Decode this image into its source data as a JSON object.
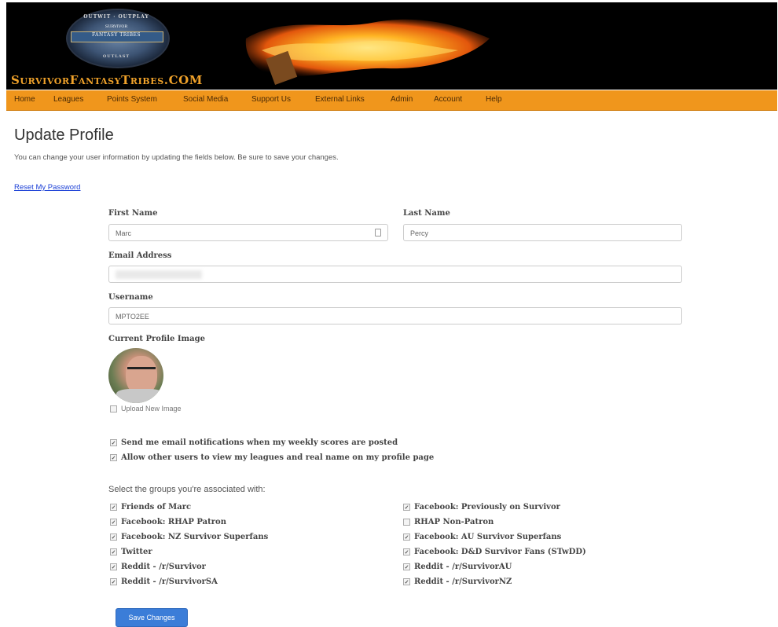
{
  "site": {
    "title": "SurvivorFantasyTribes.COM",
    "logo_top": "OUTWIT · OUTPLAY",
    "logo_mid": "SURVIVOR",
    "logo_band": "FANTASY TRIBES",
    "logo_bottom": "OUTLAST"
  },
  "nav": {
    "items": [
      "Home",
      "Leagues",
      "Points System",
      "Social Media",
      "Support Us",
      "External Links",
      "Admin",
      "Account",
      "Help"
    ]
  },
  "page": {
    "title": "Update Profile",
    "intro": "You can change your user information by updating the fields below. Be sure to save your changes.",
    "reset_link": "Reset My Password"
  },
  "form": {
    "first_name_label": "First Name",
    "first_name_value": "Marc",
    "last_name_label": "Last Name",
    "last_name_value": "Percy",
    "email_label": "Email Address",
    "username_label": "Username",
    "username_value": "MPTO2EE",
    "profile_image_label": "Current Profile Image",
    "upload_label": "Upload New Image",
    "notify_email_label": "Send me email notifications when my weekly scores are posted",
    "allow_view_label": "Allow other users to view my leagues and real name on my profile page",
    "groups_label": "Select the groups you're associated with:",
    "save_label": "Save Changes"
  },
  "groups": {
    "left": [
      {
        "label": "Friends of Marc",
        "checked": true
      },
      {
        "label": "Facebook: RHAP Patron",
        "checked": true
      },
      {
        "label": "Facebook: NZ Survivor Superfans",
        "checked": true
      },
      {
        "label": "Twitter",
        "checked": true
      },
      {
        "label": "Reddit - /r/Survivor",
        "checked": true
      },
      {
        "label": "Reddit - /r/SurvivorSA",
        "checked": true
      }
    ],
    "right": [
      {
        "label": "Facebook: Previously on Survivor",
        "checked": true
      },
      {
        "label": "RHAP Non-Patron",
        "checked": false
      },
      {
        "label": "Facebook: AU Survivor Superfans",
        "checked": true
      },
      {
        "label": "Facebook: D&D Survivor Fans (STwDD)",
        "checked": true
      },
      {
        "label": "Reddit - /r/SurvivorAU",
        "checked": true
      },
      {
        "label": "Reddit - /r/SurvivorNZ",
        "checked": true
      }
    ]
  },
  "colors": {
    "nav_bg": "#f0961c",
    "title_orange": "#f0a22a",
    "button_blue": "#3b7dd8",
    "link_blue": "#1a3fd6"
  }
}
